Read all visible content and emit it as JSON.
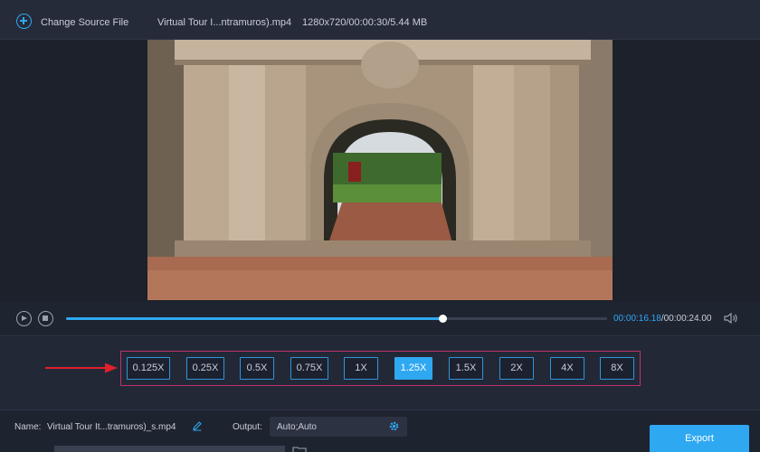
{
  "topbar": {
    "add_icon": "plus-circle-icon",
    "change_source_label": "Change Source File",
    "file_name": "Virtual Tour I...ntramuros).mp4",
    "file_meta": "1280x720/00:00:30/5.44 MB"
  },
  "player": {
    "progress_fraction": 0.695,
    "current_time": "00:00:16.18",
    "separator": "/",
    "total_time": "00:00:24.00",
    "icons": [
      "play-icon",
      "stop-icon",
      "volume-icon"
    ]
  },
  "speeds": {
    "options": [
      "0.125X",
      "0.25X",
      "0.5X",
      "0.75X",
      "1X",
      "1.25X",
      "1.5X",
      "2X",
      "4X",
      "8X"
    ],
    "selected": "1.25X"
  },
  "bottom": {
    "name_label": "Name:",
    "name_value": "Virtual Tour It...tramuros)_s.mp4",
    "output_label": "Output:",
    "output_value": "Auto;Auto",
    "export_label": "Export"
  },
  "colors": {
    "accent": "#2fa8f2",
    "highlight_frame": "#c0316a",
    "arrow": "#e0202a",
    "background": "#1f2431"
  }
}
